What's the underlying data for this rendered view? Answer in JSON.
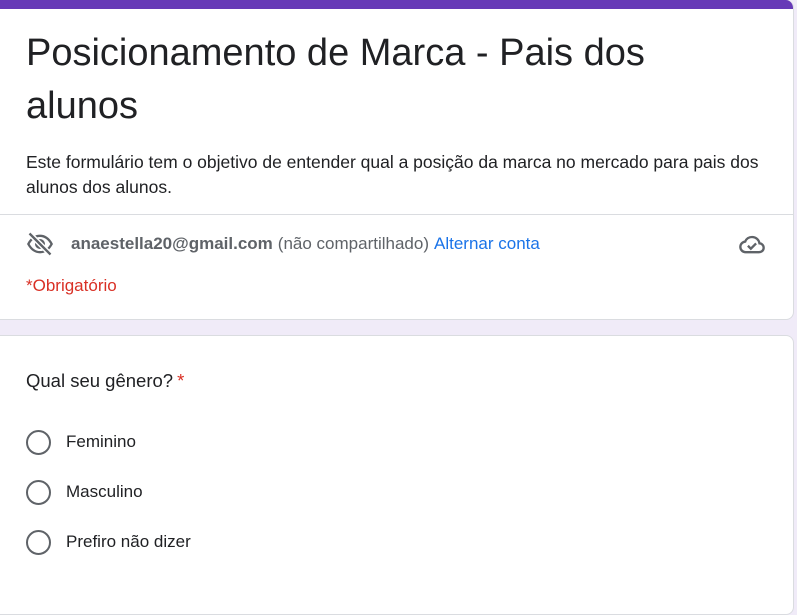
{
  "form": {
    "accent_color": "#673ab7",
    "title": "Posicionamento de Marca - Pais dos alunos",
    "description": "Este formulário tem o objetivo de entender qual a posição da marca no mercado para pais dos alunos dos alunos.",
    "required_note": "*Obrigatório"
  },
  "account": {
    "email": "anaestella20@gmail.com",
    "status": "(não compartilhado)",
    "switch_label": "Alternar conta",
    "left_icon": "eye-off-icon",
    "right_icon": "cloud-check-icon"
  },
  "question": {
    "title": "Qual seu gênero?",
    "required_mark": "*",
    "options": [
      {
        "label": "Feminino"
      },
      {
        "label": "Masculino"
      },
      {
        "label": "Prefiro não dizer"
      }
    ]
  }
}
